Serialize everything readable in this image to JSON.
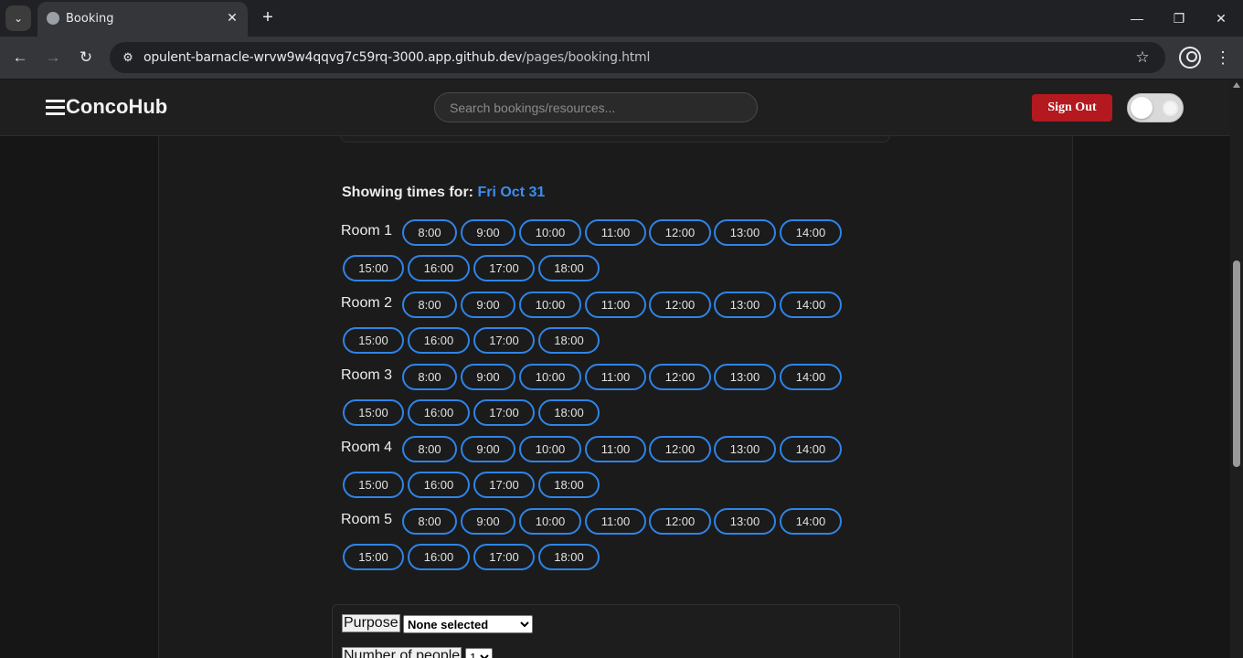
{
  "browser": {
    "tab_title": "Booking",
    "url_host": "opulent-barnacle-wrvw9w4qqvg7c59rq-3000.app.github.dev",
    "url_path": "/pages/booking.html"
  },
  "navbar": {
    "brand": "ConcoHub",
    "search_placeholder": "Search bookings/resources...",
    "signout_label": "Sign Out"
  },
  "schedule": {
    "showing_label": "Showing times for:",
    "showing_date": "Fri Oct 31",
    "rooms": [
      {
        "label": "Room 1",
        "slots": [
          "8:00",
          "9:00",
          "10:00",
          "11:00",
          "12:00",
          "13:00",
          "14:00",
          "15:00",
          "16:00",
          "17:00",
          "18:00"
        ]
      },
      {
        "label": "Room 2",
        "slots": [
          "8:00",
          "9:00",
          "10:00",
          "11:00",
          "12:00",
          "13:00",
          "14:00",
          "15:00",
          "16:00",
          "17:00",
          "18:00"
        ]
      },
      {
        "label": "Room 3",
        "slots": [
          "8:00",
          "9:00",
          "10:00",
          "11:00",
          "12:00",
          "13:00",
          "14:00",
          "15:00",
          "16:00",
          "17:00",
          "18:00"
        ]
      },
      {
        "label": "Room 4",
        "slots": [
          "8:00",
          "9:00",
          "10:00",
          "11:00",
          "12:00",
          "13:00",
          "14:00",
          "15:00",
          "16:00",
          "17:00",
          "18:00"
        ]
      },
      {
        "label": "Room 5",
        "slots": [
          "8:00",
          "9:00",
          "10:00",
          "11:00",
          "12:00",
          "13:00",
          "14:00",
          "15:00",
          "16:00",
          "17:00",
          "18:00"
        ]
      }
    ]
  },
  "form": {
    "purpose_label": "Purpose",
    "purpose_value": "None selected",
    "people_label": "Number of people",
    "people_value": "1"
  },
  "colors": {
    "accent": "#3d8ef0",
    "slot_border": "#2f84e6",
    "signout_bg": "#b3191e"
  }
}
